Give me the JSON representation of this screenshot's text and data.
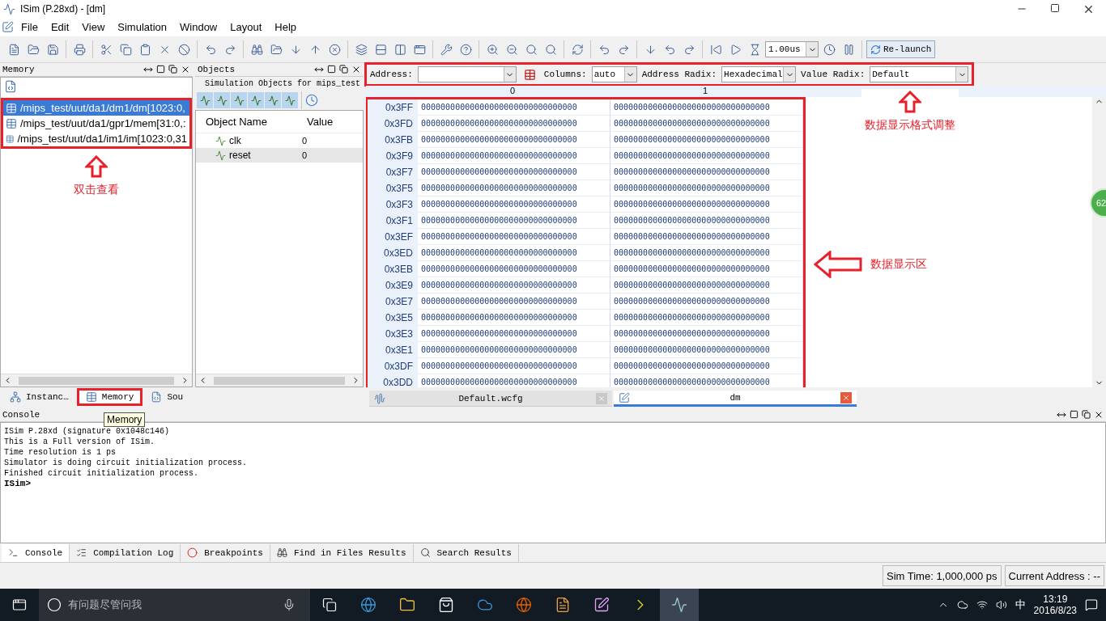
{
  "window": {
    "title": "ISim (P.28xd) - [dm]"
  },
  "menu": [
    "File",
    "Edit",
    "View",
    "Simulation",
    "Window",
    "Layout",
    "Help"
  ],
  "toolbar": {
    "time_value": "1.00us",
    "relaunch": "Re-launch"
  },
  "memory_panel": {
    "title": "Memory",
    "items": [
      {
        "label": "/mips_test/uut/da1/dm1/dm[1023:0,",
        "selected": true
      },
      {
        "label": "/mips_test/uut/da1/gpr1/mem[31:0,:",
        "selected": false
      },
      {
        "label": "/mips_test/uut/da1/im1/im[1023:0,31",
        "selected": false
      }
    ],
    "tabs": [
      {
        "label": "Instanc…",
        "selected": false
      },
      {
        "label": "Memory",
        "selected": true
      },
      {
        "label": "Sou",
        "selected": false
      }
    ],
    "tooltip": "Memory"
  },
  "objects_panel": {
    "title": "Objects",
    "subtitle": "Simulation Objects for mips_test",
    "columns": [
      "Object Name",
      "Value"
    ],
    "rows": [
      {
        "name": "clk",
        "value": "0",
        "selected": false
      },
      {
        "name": "reset",
        "value": "0",
        "selected": true
      }
    ]
  },
  "memory_view": {
    "address_label": "Address:",
    "columns_label": "Columns:",
    "columns_value": "auto",
    "address_radix_label": "Address Radix:",
    "address_radix_value": "Hexadecimal",
    "value_radix_label": "Value Radix:",
    "value_radix_value": "Default",
    "column_headers": [
      "0",
      "1"
    ],
    "rows": [
      {
        "address": "0x3FF",
        "values": [
          "00000000000000000000000000000000",
          "00000000000000000000000000000000"
        ]
      },
      {
        "address": "0x3FD",
        "values": [
          "00000000000000000000000000000000",
          "00000000000000000000000000000000"
        ]
      },
      {
        "address": "0x3FB",
        "values": [
          "00000000000000000000000000000000",
          "00000000000000000000000000000000"
        ]
      },
      {
        "address": "0x3F9",
        "values": [
          "00000000000000000000000000000000",
          "00000000000000000000000000000000"
        ]
      },
      {
        "address": "0x3F7",
        "values": [
          "00000000000000000000000000000000",
          "00000000000000000000000000000000"
        ]
      },
      {
        "address": "0x3F5",
        "values": [
          "00000000000000000000000000000000",
          "00000000000000000000000000000000"
        ]
      },
      {
        "address": "0x3F3",
        "values": [
          "00000000000000000000000000000000",
          "00000000000000000000000000000000"
        ]
      },
      {
        "address": "0x3F1",
        "values": [
          "00000000000000000000000000000000",
          "00000000000000000000000000000000"
        ]
      },
      {
        "address": "0x3EF",
        "values": [
          "00000000000000000000000000000000",
          "00000000000000000000000000000000"
        ]
      },
      {
        "address": "0x3ED",
        "values": [
          "00000000000000000000000000000000",
          "00000000000000000000000000000000"
        ]
      },
      {
        "address": "0x3EB",
        "values": [
          "00000000000000000000000000000000",
          "00000000000000000000000000000000"
        ]
      },
      {
        "address": "0x3E9",
        "values": [
          "00000000000000000000000000000000",
          "00000000000000000000000000000000"
        ]
      },
      {
        "address": "0x3E7",
        "values": [
          "00000000000000000000000000000000",
          "00000000000000000000000000000000"
        ]
      },
      {
        "address": "0x3E5",
        "values": [
          "00000000000000000000000000000000",
          "00000000000000000000000000000000"
        ]
      },
      {
        "address": "0x3E3",
        "values": [
          "00000000000000000000000000000000",
          "00000000000000000000000000000000"
        ]
      },
      {
        "address": "0x3E1",
        "values": [
          "00000000000000000000000000000000",
          "00000000000000000000000000000000"
        ]
      },
      {
        "address": "0x3DF",
        "values": [
          "00000000000000000000000000000000",
          "00000000000000000000000000000000"
        ]
      },
      {
        "address": "0x3DD",
        "values": [
          "00000000000000000000000000000000",
          "00000000000000000000000000000000"
        ]
      }
    ]
  },
  "editor_tabs": [
    {
      "label": "Default.wcfg",
      "selected": false
    },
    {
      "label": "dm",
      "selected": true
    }
  ],
  "annotations": [
    "双击查看",
    "数据显示格式调整",
    "数据显示区"
  ],
  "badge": "62",
  "console": {
    "title": "Console",
    "lines": [
      "ISim P.28xd (signature 0x1048c146)",
      "This is a Full version of ISim.",
      "Time resolution is 1 ps",
      "Simulator is doing circuit initialization process.",
      "Finished circuit initialization process."
    ],
    "prompt": "ISim>"
  },
  "bottom_tabs": [
    {
      "label": "Console",
      "selected": true
    },
    {
      "label": "Compilation Log",
      "selected": false
    },
    {
      "label": "Breakpoints",
      "selected": false
    },
    {
      "label": "Find in Files Results",
      "selected": false
    },
    {
      "label": "Search Results",
      "selected": false
    }
  ],
  "status": {
    "sim_time": "Sim Time: 1,000,000 ps",
    "current_address": "Current Address : --"
  },
  "taskbar": {
    "search_placeholder": "有问题尽管问我",
    "ime": "中",
    "time": "13:19",
    "date": "2016/8/23"
  }
}
